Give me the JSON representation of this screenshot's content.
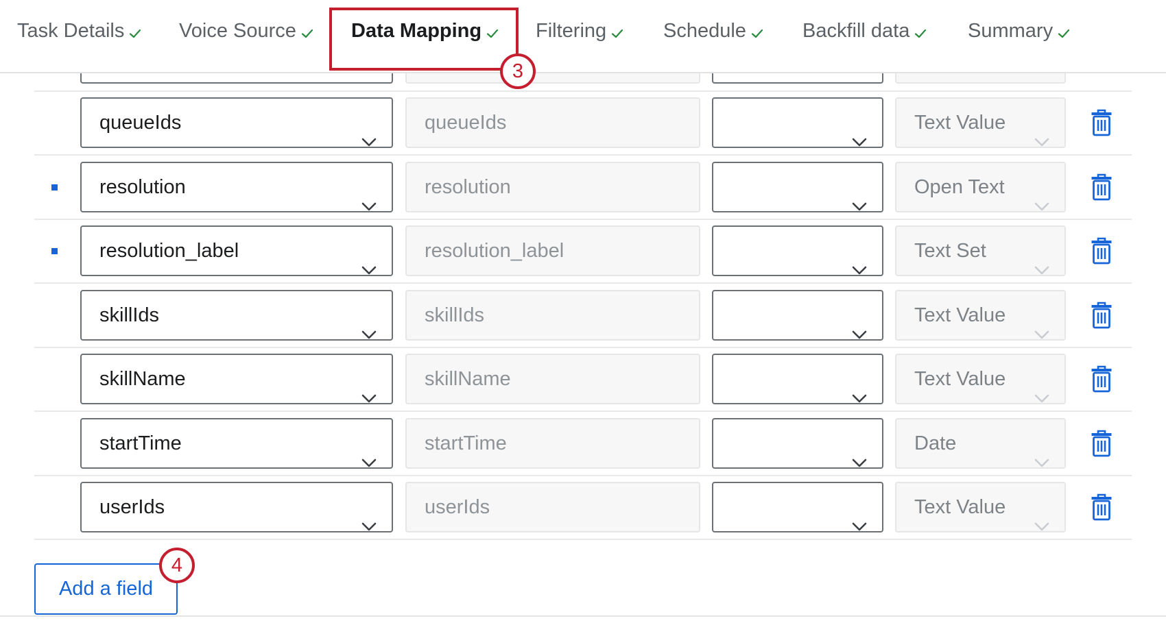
{
  "tabs": [
    {
      "label": "Task Details",
      "complete": true
    },
    {
      "label": "Voice Source",
      "complete": true
    },
    {
      "label": "Data Mapping",
      "complete": true,
      "active": true
    },
    {
      "label": "Filtering",
      "complete": true
    },
    {
      "label": "Schedule",
      "complete": true
    },
    {
      "label": "Backfill data",
      "complete": true
    },
    {
      "label": "Summary",
      "complete": true
    }
  ],
  "callouts": {
    "data_mapping_step": "3",
    "add_field_step": "4"
  },
  "rows": [
    {
      "source_field": "queueIds",
      "field_name": "queueIds",
      "mapped_value": "",
      "field_type": "Text Value",
      "required": false
    },
    {
      "source_field": "resolution",
      "field_name": "resolution",
      "mapped_value": "",
      "field_type": "Open Text",
      "required": true
    },
    {
      "source_field": "resolution_label",
      "field_name": "resolution_label",
      "mapped_value": "",
      "field_type": "Text Set",
      "required": true
    },
    {
      "source_field": "skillIds",
      "field_name": "skillIds",
      "mapped_value": "",
      "field_type": "Text Value",
      "required": false
    },
    {
      "source_field": "skillName",
      "field_name": "skillName",
      "mapped_value": "",
      "field_type": "Text Value",
      "required": false
    },
    {
      "source_field": "startTime",
      "field_name": "startTime",
      "mapped_value": "",
      "field_type": "Date",
      "required": false
    },
    {
      "source_field": "userIds",
      "field_name": "userIds",
      "mapped_value": "",
      "field_type": "Text Value",
      "required": false
    }
  ],
  "add_field_label": "Add a field",
  "colors": {
    "accent": "#1565d8",
    "callout": "#c41e2f",
    "check": "#2a8a3e"
  },
  "icons": {
    "complete": "check-icon",
    "dropdown": "chevron-down-icon",
    "delete": "trash-icon"
  }
}
